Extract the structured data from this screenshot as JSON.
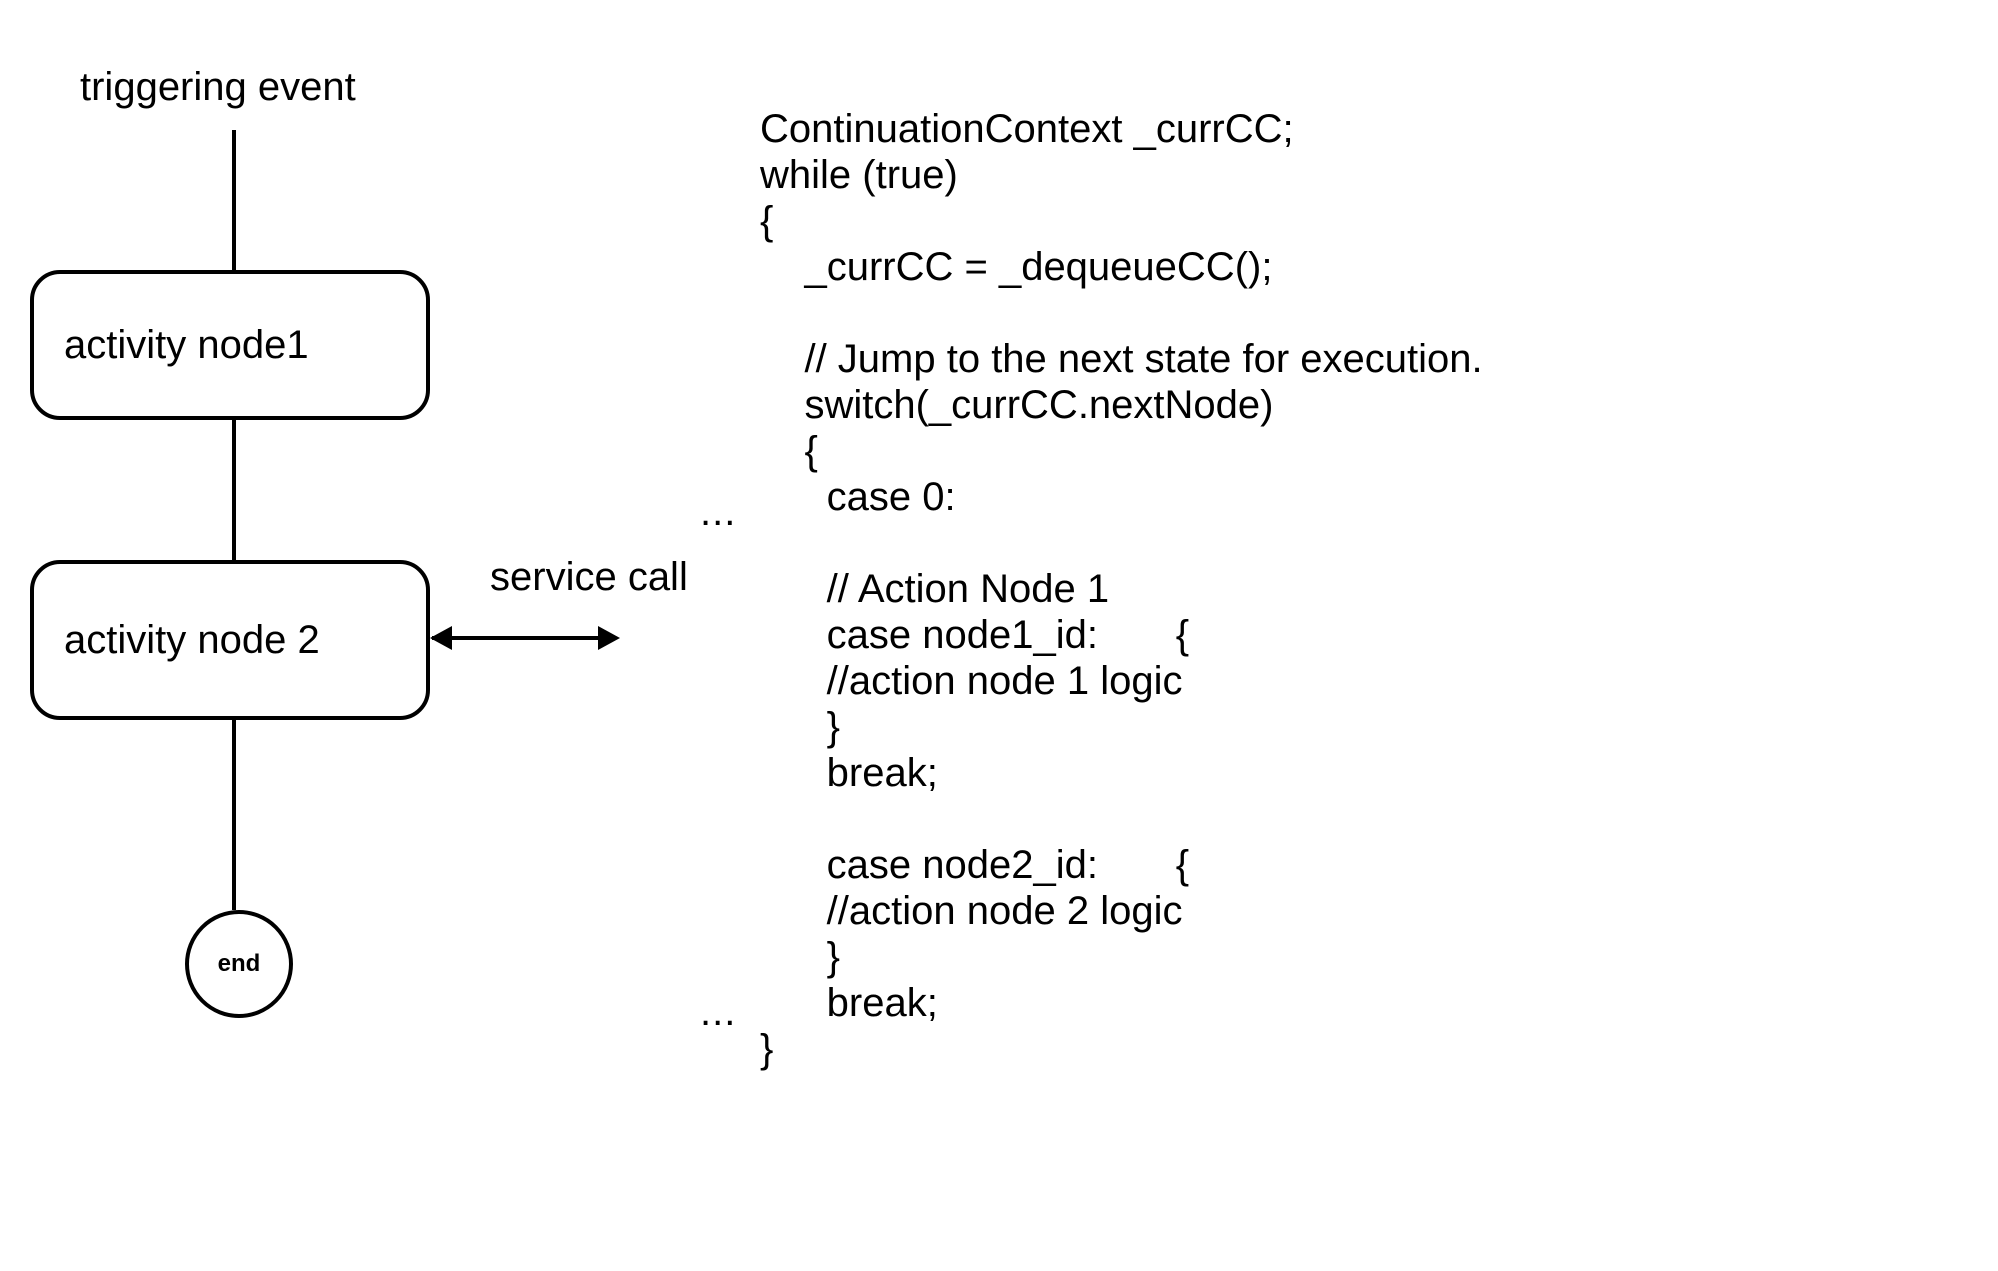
{
  "labels": {
    "trigger": "triggering event",
    "node1": "activity node1",
    "node2": "activity node 2",
    "service": "service call",
    "end": "end"
  },
  "code": {
    "l1": "ContinuationContext _currCC;",
    "l2": "while (true)",
    "l3": "{",
    "l4": "    _currCC = _dequeueCC();",
    "l5": "",
    "l6": "    // Jump to the next state for execution.",
    "l7": "    switch(_currCC.nextNode)",
    "l8": "    {",
    "l9": "      case 0:",
    "l10": "",
    "l11": "      // Action Node 1",
    "l12": "      case node1_id:       {",
    "l13": "      //action node 1 logic",
    "l14": "      }",
    "l15": "      break;",
    "l16": "",
    "l17": "      case node2_id:       {",
    "l18": "      //action node 2 logic",
    "l19": "      }",
    "l20": "      break;",
    "l21": "}"
  },
  "ellipsis": "..."
}
